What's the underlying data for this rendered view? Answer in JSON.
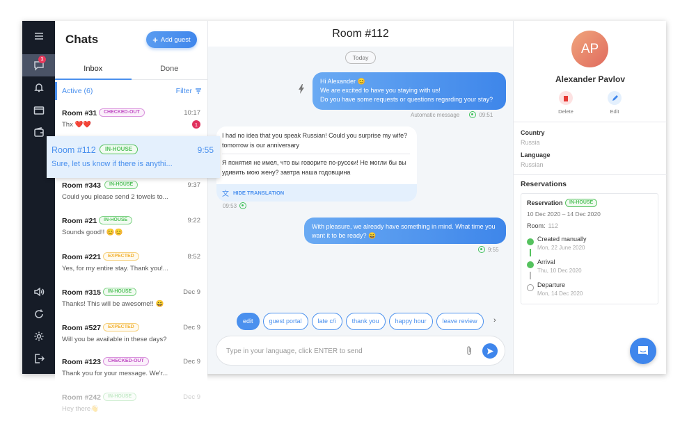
{
  "sidebar": {
    "items": [
      {
        "icon": "menu-icon"
      },
      {
        "icon": "chat-icon",
        "badge": "1",
        "active": true
      },
      {
        "icon": "bell-icon"
      },
      {
        "icon": "payment-card-icon"
      },
      {
        "icon": "wallet-icon"
      },
      {
        "icon": "sound-icon"
      },
      {
        "icon": "refresh-icon"
      },
      {
        "icon": "settings-icon"
      },
      {
        "icon": "logout-icon"
      }
    ]
  },
  "chatlist": {
    "title": "Chats",
    "add_guest_label": "Add guest",
    "tabs": [
      {
        "label": "Inbox",
        "active": true
      },
      {
        "label": "Done",
        "active": false
      }
    ],
    "active_label": "Active (6)",
    "filter_label": "Filter",
    "selected": {
      "room": "Room #112",
      "tag": "IN-HOUSE",
      "time": "9:55",
      "message": "Sure, let us know if there is anythi..."
    },
    "items": [
      {
        "room": "Room #31",
        "tag": "CHECKED-OUT",
        "time": "10:17",
        "message": "Thx ❤️❤️",
        "unread": "1"
      },
      {
        "room": "Room #343",
        "tag": "IN-HOUSE",
        "time": "9:37",
        "message": "Could you please send 2 towels to..."
      },
      {
        "room": "Room #21",
        "tag": "IN-HOUSE",
        "time": "9:22",
        "message": "Sounds good!! 😊😊"
      },
      {
        "room": "Room #221",
        "tag": "EXPECTED",
        "time": "8:52",
        "message": "Yes, for my entire stay. Thank you!..."
      },
      {
        "room": "Room #315",
        "tag": "IN-HOUSE",
        "time": "Dec 9",
        "message": "Thanks! This will be awesome!! 😄"
      },
      {
        "room": "Room #527",
        "tag": "EXPECTED",
        "time": "Dec 9",
        "message": "Will you be available in these days?"
      },
      {
        "room": "Room #123",
        "tag": "CHECKED-OUT",
        "time": "Dec 9",
        "message": "Thank you for your message. We'r..."
      },
      {
        "room": "Room #242",
        "tag": "IN-HOUSE",
        "time": "Dec 9",
        "message": "Hey there👋"
      }
    ]
  },
  "chat": {
    "title": "Room #112",
    "date_divider": "Today",
    "messages": [
      {
        "direction": "out",
        "lines": [
          "Hi Alexander 😊",
          "We are excited to have you staying with us!",
          "Do you have some requests or questions regarding your stay?"
        ],
        "note": "Automatic message",
        "time": "09:51",
        "channel": "whatsapp"
      },
      {
        "direction": "in",
        "original": "I had no idea that you speak Russian! Could you surprise my wife? tomorrow is our anniversary",
        "translation": "Я понятия не имел, что вы говорите по-русски! Не могли бы вы удивить мою жену? завтра наша годовщина",
        "translation_toggle": "HIDE TRANSLATION",
        "time": "09:53",
        "channel": "whatsapp"
      },
      {
        "direction": "out",
        "text": "With pleasure, we already have something in mind. What time you want it to be ready? 😄",
        "time": "9:55",
        "channel": "whatsapp"
      }
    ],
    "quick_replies": [
      "edit",
      "guest portal",
      "late c/i",
      "thank you",
      "happy hour",
      "leave review"
    ],
    "composer_placeholder": "Type in your language, click ENTER to send"
  },
  "profile": {
    "initials": "AP",
    "name": "Alexander Pavlov",
    "actions": [
      {
        "label": "Delete"
      },
      {
        "label": "Edit"
      }
    ],
    "fields": [
      {
        "label": "Country",
        "value": "Russia"
      },
      {
        "label": "Language",
        "value": "Russian"
      }
    ],
    "reservations_title": "Reservations",
    "reservation": {
      "title": "Reservation",
      "tag": "IN-HOUSE",
      "dates": "10 Dec 2020 – 14 Dec 2020",
      "room_label": "Room:",
      "room_value": "112",
      "timeline": [
        {
          "title": "Created manually",
          "date": "Mon, 22 June 2020",
          "done": true
        },
        {
          "title": "Arrival",
          "date": "Thu, 10 Dec 2020",
          "done": true
        },
        {
          "title": "Departure",
          "date": "Mon, 14 Dec 2020",
          "done": false
        }
      ]
    }
  },
  "colors": {
    "accent": "#4a90ee",
    "rail": "#161c27",
    "in_house": "#55c25e",
    "expected": "#f2b43b",
    "checked_out": "#c04fc4",
    "unread": "#e0315d"
  }
}
